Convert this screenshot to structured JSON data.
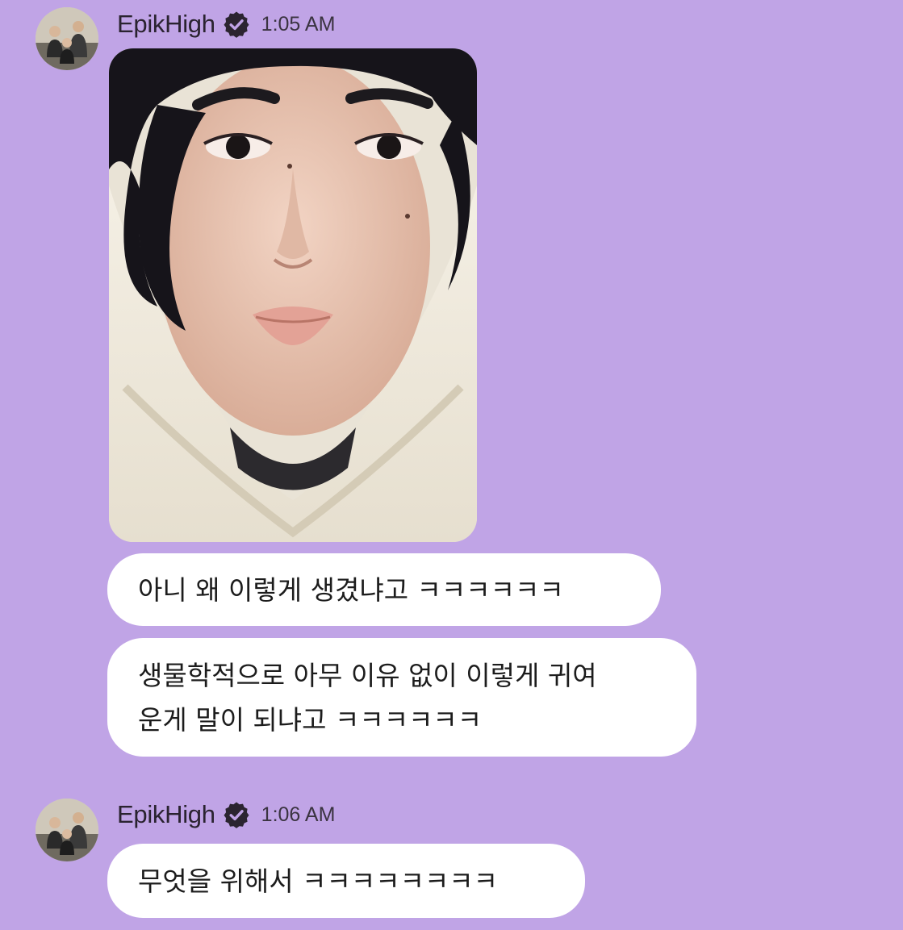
{
  "messages": [
    {
      "sender": "EpikHigh",
      "time": "1:05 AM",
      "verified": true,
      "attachment": "photo",
      "texts": [
        "아니 왜 이렇게 생겼냐고 ㅋㅋㅋㅋㅋㅋ",
        "생물학적으로 아무 이유 없이 이렇게 귀여\n운게 말이 되냐고 ㅋㅋㅋㅋㅋㅋ"
      ]
    },
    {
      "sender": "EpikHigh",
      "time": "1:06 AM",
      "verified": true,
      "texts": [
        "무엇을 위해서 ㅋㅋㅋㅋㅋㅋㅋㅋ"
      ]
    }
  ],
  "colors": {
    "background": "#c0a4e6",
    "bubble": "#ffffff",
    "verified_badge": "#2b2430"
  },
  "icons": {
    "verified": "verified-check-icon",
    "avatar": "group-photo-avatar"
  }
}
